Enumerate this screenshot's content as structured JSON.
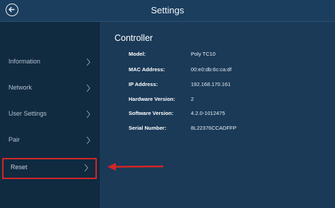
{
  "header": {
    "title": "Settings"
  },
  "sidebar": {
    "items": [
      {
        "label": "Information"
      },
      {
        "label": "Network"
      },
      {
        "label": "User Settings"
      },
      {
        "label": "Pair"
      },
      {
        "label": "Reset"
      }
    ]
  },
  "main": {
    "section_title": "Controller",
    "rows": [
      {
        "key": "Model:",
        "value": "Poly TC10"
      },
      {
        "key": "MAC Address:",
        "value": "00:e0:db:6c:ca:df"
      },
      {
        "key": "IP Address:",
        "value": "192.168.170.161"
      },
      {
        "key": "Hardware Version:",
        "value": "2"
      },
      {
        "key": "Software Version:",
        "value": "4.2.0-1012475"
      },
      {
        "key": "Serial Number:",
        "value": "8L22376CCADFFP"
      }
    ]
  },
  "colors": {
    "header_bg": "#1b3e5e",
    "sidebar_bg": "#102a40",
    "content_bg": "#1a3a58",
    "highlight": "#d22626"
  }
}
